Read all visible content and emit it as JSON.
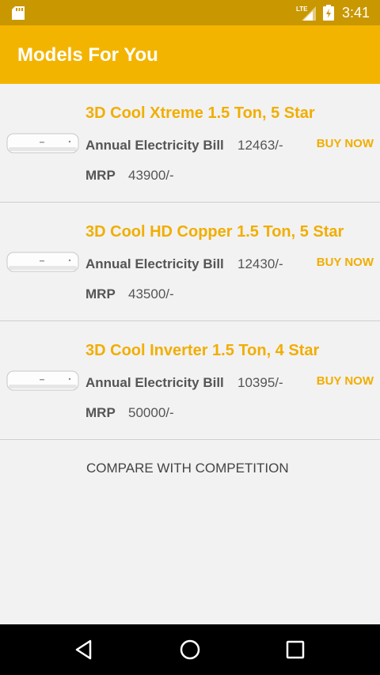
{
  "status_bar": {
    "network": "LTE",
    "time": "3:41",
    "icons": [
      "sd-card-icon",
      "lte-signal-icon",
      "battery-charging-icon"
    ]
  },
  "app_bar": {
    "title": "Models For You"
  },
  "models": [
    {
      "name": "3D Cool Xtreme 1.5 Ton, 5 Star",
      "bill_label": "Annual Electricity Bill",
      "bill_value": "12463/-",
      "mrp_label": "MRP",
      "mrp_value": "43900/-",
      "buy_label": "BUY NOW"
    },
    {
      "name": "3D Cool HD Copper 1.5 Ton, 5 Star",
      "bill_label": "Annual Electricity Bill",
      "bill_value": "12430/-",
      "mrp_label": "MRP",
      "mrp_value": "43500/-",
      "buy_label": "BUY NOW"
    },
    {
      "name": "3D Cool Inverter 1.5 Ton, 4 Star",
      "bill_label": "Annual Electricity Bill",
      "bill_value": "10395/-",
      "mrp_label": "MRP",
      "mrp_value": "50000/-",
      "buy_label": "BUY NOW"
    }
  ],
  "compare_label": "COMPARE WITH COMPETITION",
  "nav_bar": {
    "icons": [
      "back-icon",
      "home-icon",
      "recents-icon"
    ]
  },
  "colors": {
    "status_bar": "#c99700",
    "app_bar": "#f3b400",
    "accent": "#f1ae00",
    "background": "#f2f2f2",
    "text": "#555555"
  }
}
